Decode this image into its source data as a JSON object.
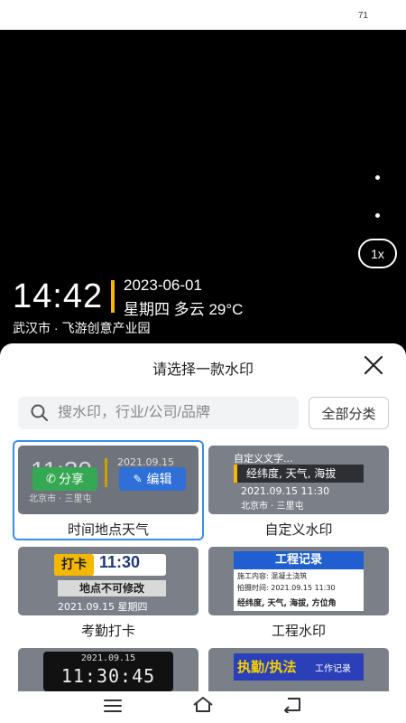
{
  "status": {
    "battery": "71"
  },
  "camera": {
    "zoom": "1x",
    "watermark": {
      "time": "14:42",
      "date": "2023-06-01",
      "weather": "星期四 多云 29°C",
      "location": "武汉市 · 飞游创意产业园"
    }
  },
  "sheet": {
    "title": "请选择一款水印",
    "search_placeholder": "搜水印，行业/公司/品牌",
    "all_categories": "全部分类",
    "share_label": "分享",
    "edit_label": "编辑",
    "cards": [
      {
        "label": "时间地点天气",
        "preview": {
          "time": "11:30",
          "date": "2021.09.15",
          "loc": "北京市 · 三里屯"
        }
      },
      {
        "label": "自定义水印",
        "preview": {
          "title": "自定义文字...",
          "line1": "经纬度, 天气, 海拔",
          "date": "2021.09.15  11:30",
          "loc": "北京市 · 三里屯"
        }
      },
      {
        "label": "考勤打卡",
        "preview": {
          "badge": "打卡",
          "time": "11:30",
          "line1": "地点不可修改",
          "date": "2021.09.15  星期四"
        }
      },
      {
        "label": "工程水印",
        "preview": {
          "title": "工程记录",
          "line1": "施工内容: 混凝土浇筑",
          "line2": "拍摄时间: 2021.09.15 11:30",
          "line3": "经纬度, 天气, 海拔, 方位角"
        }
      },
      {
        "label": "",
        "preview": {
          "date": "2021.09.15",
          "time": "11:30:45"
        }
      },
      {
        "label": "",
        "preview": {
          "title": "执勤/执法",
          "tag": "工作记录"
        }
      }
    ]
  }
}
